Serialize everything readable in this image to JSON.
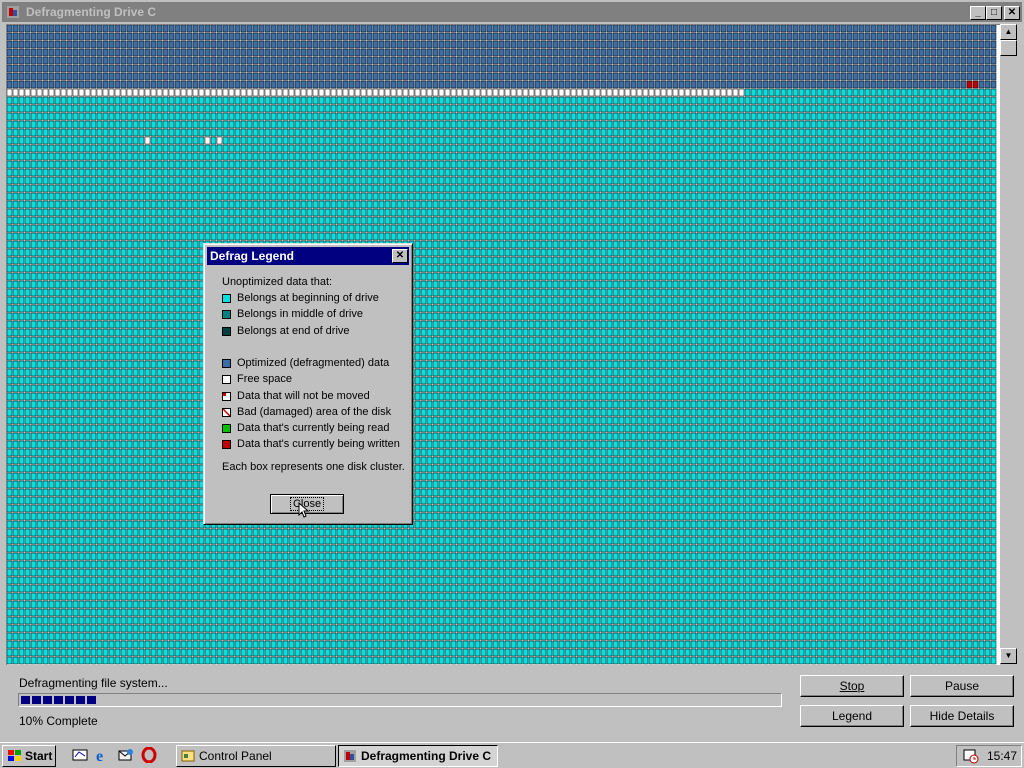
{
  "window": {
    "title": "Defragmenting Drive C",
    "min_label": "_",
    "max_label": "□",
    "close_label": "✕"
  },
  "colors": {
    "optimized": "#3a6ea5",
    "unoptimized_beginning": "#00e0e0",
    "unoptimized_middle": "#008080",
    "unoptimized_end": "#004040",
    "free": "#ffffff",
    "written": "#c00000",
    "reading": "#00c000"
  },
  "status": {
    "text": "Defragmenting file system...",
    "percent_text": "10% Complete",
    "progress_fraction": 0.1
  },
  "buttons": {
    "stop": "Stop",
    "pause": "Pause",
    "legend": "Legend",
    "hide_details": "Hide Details"
  },
  "legend": {
    "title": "Defrag Legend",
    "close_x": "✕",
    "intro": "Unoptimized data that:",
    "items_group1": [
      {
        "label": "Belongs at beginning of drive",
        "color": "#00e0e0"
      },
      {
        "label": "Belongs in middle of drive",
        "color": "#008080"
      },
      {
        "label": "Belongs at end of drive",
        "color": "#004040"
      }
    ],
    "items_group2": [
      {
        "label": "Optimized (defragmented) data",
        "color": "#3a6ea5"
      },
      {
        "label": "Free space",
        "color": "#ffffff"
      },
      {
        "label": "Data that will not be moved",
        "color": "#ffffff"
      },
      {
        "label": "Bad (damaged) area of the disk",
        "color": "#ffffff"
      },
      {
        "label": "Data that's currently being read",
        "color": "#00c000"
      },
      {
        "label": "Data that's currently being written",
        "color": "#c00000"
      }
    ],
    "footer": "Each box represents one disk cluster.",
    "close_button": "Close"
  },
  "taskbar": {
    "start_label": "Start",
    "items": [
      {
        "label": "Control Panel"
      },
      {
        "label": "Defragmenting Drive C"
      }
    ],
    "clock": "15:47"
  }
}
